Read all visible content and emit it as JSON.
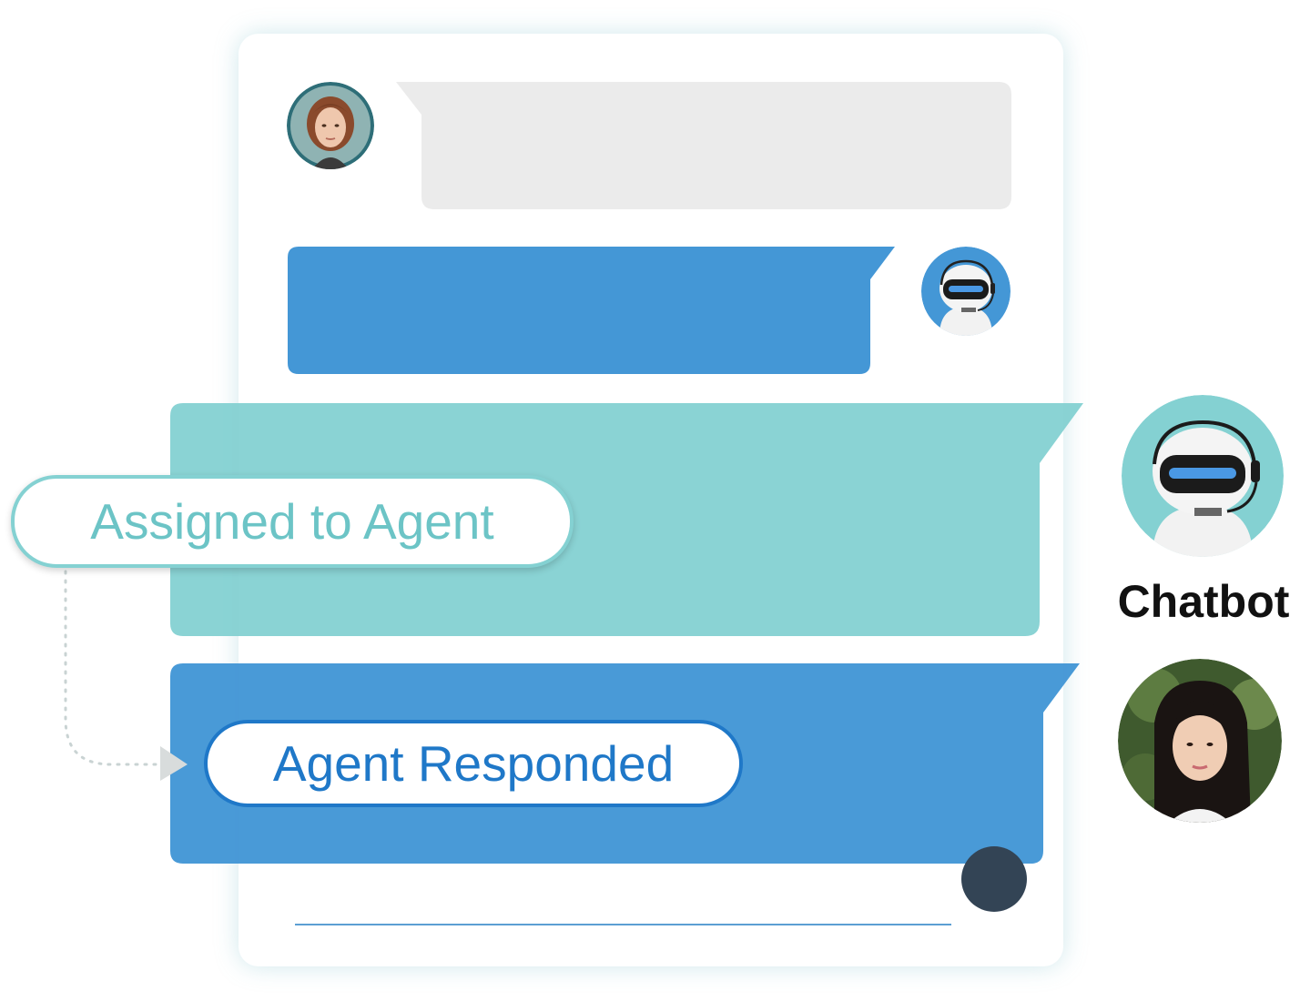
{
  "labels": {
    "assigned": "Assigned to Agent",
    "responded": "Agent Responded",
    "chatbot": "Chatbot"
  },
  "icons": {
    "customer_avatar": "customer-avatar",
    "bot_avatar_small": "chatbot-avatar",
    "bot_avatar_large": "chatbot-avatar",
    "agent_avatar": "agent-avatar",
    "send_button": "send-dot"
  },
  "colors": {
    "customer_bubble": "#ebebeb",
    "bot_bubble": "#4497d6",
    "assigned_bubble": "#84d1d2",
    "agent_bubble": "#4497d6",
    "assigned_text": "#6cc4c6",
    "responded_text": "#1f78c8",
    "send_dot": "#334455"
  }
}
